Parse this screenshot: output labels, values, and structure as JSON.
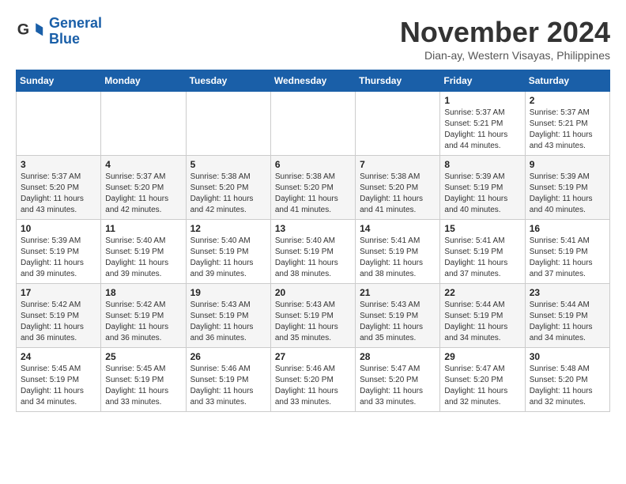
{
  "logo": {
    "line1": "General",
    "line2": "Blue"
  },
  "title": "November 2024",
  "location": "Dian-ay, Western Visayas, Philippines",
  "weekdays": [
    "Sunday",
    "Monday",
    "Tuesday",
    "Wednesday",
    "Thursday",
    "Friday",
    "Saturday"
  ],
  "weeks": [
    [
      {
        "day": "",
        "info": ""
      },
      {
        "day": "",
        "info": ""
      },
      {
        "day": "",
        "info": ""
      },
      {
        "day": "",
        "info": ""
      },
      {
        "day": "",
        "info": ""
      },
      {
        "day": "1",
        "info": "Sunrise: 5:37 AM\nSunset: 5:21 PM\nDaylight: 11 hours and 44 minutes."
      },
      {
        "day": "2",
        "info": "Sunrise: 5:37 AM\nSunset: 5:21 PM\nDaylight: 11 hours and 43 minutes."
      }
    ],
    [
      {
        "day": "3",
        "info": "Sunrise: 5:37 AM\nSunset: 5:20 PM\nDaylight: 11 hours and 43 minutes."
      },
      {
        "day": "4",
        "info": "Sunrise: 5:37 AM\nSunset: 5:20 PM\nDaylight: 11 hours and 42 minutes."
      },
      {
        "day": "5",
        "info": "Sunrise: 5:38 AM\nSunset: 5:20 PM\nDaylight: 11 hours and 42 minutes."
      },
      {
        "day": "6",
        "info": "Sunrise: 5:38 AM\nSunset: 5:20 PM\nDaylight: 11 hours and 41 minutes."
      },
      {
        "day": "7",
        "info": "Sunrise: 5:38 AM\nSunset: 5:20 PM\nDaylight: 11 hours and 41 minutes."
      },
      {
        "day": "8",
        "info": "Sunrise: 5:39 AM\nSunset: 5:19 PM\nDaylight: 11 hours and 40 minutes."
      },
      {
        "day": "9",
        "info": "Sunrise: 5:39 AM\nSunset: 5:19 PM\nDaylight: 11 hours and 40 minutes."
      }
    ],
    [
      {
        "day": "10",
        "info": "Sunrise: 5:39 AM\nSunset: 5:19 PM\nDaylight: 11 hours and 39 minutes."
      },
      {
        "day": "11",
        "info": "Sunrise: 5:40 AM\nSunset: 5:19 PM\nDaylight: 11 hours and 39 minutes."
      },
      {
        "day": "12",
        "info": "Sunrise: 5:40 AM\nSunset: 5:19 PM\nDaylight: 11 hours and 39 minutes."
      },
      {
        "day": "13",
        "info": "Sunrise: 5:40 AM\nSunset: 5:19 PM\nDaylight: 11 hours and 38 minutes."
      },
      {
        "day": "14",
        "info": "Sunrise: 5:41 AM\nSunset: 5:19 PM\nDaylight: 11 hours and 38 minutes."
      },
      {
        "day": "15",
        "info": "Sunrise: 5:41 AM\nSunset: 5:19 PM\nDaylight: 11 hours and 37 minutes."
      },
      {
        "day": "16",
        "info": "Sunrise: 5:41 AM\nSunset: 5:19 PM\nDaylight: 11 hours and 37 minutes."
      }
    ],
    [
      {
        "day": "17",
        "info": "Sunrise: 5:42 AM\nSunset: 5:19 PM\nDaylight: 11 hours and 36 minutes."
      },
      {
        "day": "18",
        "info": "Sunrise: 5:42 AM\nSunset: 5:19 PM\nDaylight: 11 hours and 36 minutes."
      },
      {
        "day": "19",
        "info": "Sunrise: 5:43 AM\nSunset: 5:19 PM\nDaylight: 11 hours and 36 minutes."
      },
      {
        "day": "20",
        "info": "Sunrise: 5:43 AM\nSunset: 5:19 PM\nDaylight: 11 hours and 35 minutes."
      },
      {
        "day": "21",
        "info": "Sunrise: 5:43 AM\nSunset: 5:19 PM\nDaylight: 11 hours and 35 minutes."
      },
      {
        "day": "22",
        "info": "Sunrise: 5:44 AM\nSunset: 5:19 PM\nDaylight: 11 hours and 34 minutes."
      },
      {
        "day": "23",
        "info": "Sunrise: 5:44 AM\nSunset: 5:19 PM\nDaylight: 11 hours and 34 minutes."
      }
    ],
    [
      {
        "day": "24",
        "info": "Sunrise: 5:45 AM\nSunset: 5:19 PM\nDaylight: 11 hours and 34 minutes."
      },
      {
        "day": "25",
        "info": "Sunrise: 5:45 AM\nSunset: 5:19 PM\nDaylight: 11 hours and 33 minutes."
      },
      {
        "day": "26",
        "info": "Sunrise: 5:46 AM\nSunset: 5:19 PM\nDaylight: 11 hours and 33 minutes."
      },
      {
        "day": "27",
        "info": "Sunrise: 5:46 AM\nSunset: 5:20 PM\nDaylight: 11 hours and 33 minutes."
      },
      {
        "day": "28",
        "info": "Sunrise: 5:47 AM\nSunset: 5:20 PM\nDaylight: 11 hours and 33 minutes."
      },
      {
        "day": "29",
        "info": "Sunrise: 5:47 AM\nSunset: 5:20 PM\nDaylight: 11 hours and 32 minutes."
      },
      {
        "day": "30",
        "info": "Sunrise: 5:48 AM\nSunset: 5:20 PM\nDaylight: 11 hours and 32 minutes."
      }
    ]
  ]
}
